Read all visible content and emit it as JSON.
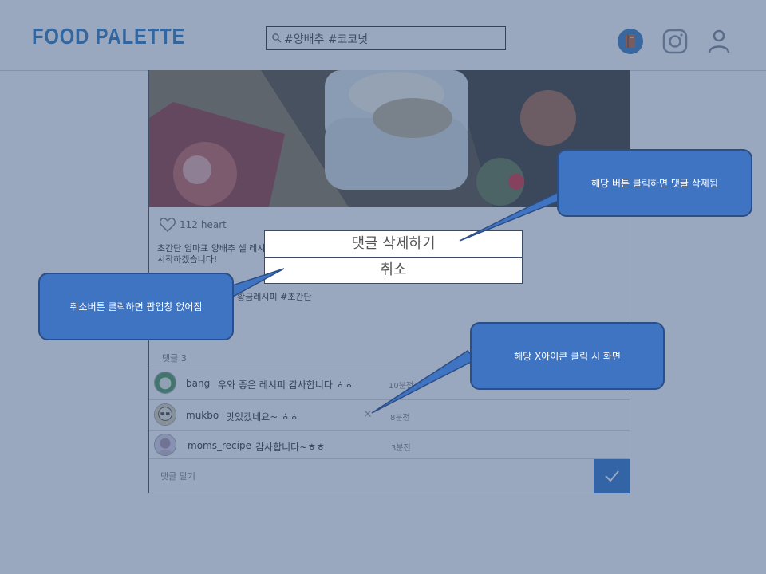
{
  "header": {
    "logo": "FOOD PALETTE",
    "search_text": "#양배추 #코코넛"
  },
  "post": {
    "likes_count": "112",
    "likes_label": "heart",
    "caption": "초간단 엄마표 양배추 샐 레시피 시작하겠습니다!",
    "hashtags": "황금레시피 #초간단",
    "comments_label": "댓글 3",
    "comments": [
      {
        "user": "bang",
        "text": "우와 좋은 레시피 감사합니다 ㅎㅎ",
        "time": "10분전"
      },
      {
        "user": "mukbo",
        "text": "맛있겠네요~ ㅎㅎ",
        "time": "8분전",
        "delete_icon": "✕"
      },
      {
        "user": "moms_recipe",
        "text": "감사합니다~ㅎㅎ",
        "time": "3분전"
      }
    ],
    "comment_placeholder": "댓글 달기"
  },
  "popup": {
    "delete_label": "댓글 삭제하기",
    "cancel_label": "취소"
  },
  "callouts": {
    "delete_note": "해당 버튼 클릭하면 댓글 삭제됨",
    "cancel_note": "취소버튼 클릭하면 팝업창 없어짐",
    "x_note": "해당 X아이콘 클릭 시 화면"
  },
  "colors": {
    "accent": "#1d6db5",
    "send_button": "#1e6bc7",
    "callout": "#3f74c2",
    "overlay": "#46608a"
  }
}
